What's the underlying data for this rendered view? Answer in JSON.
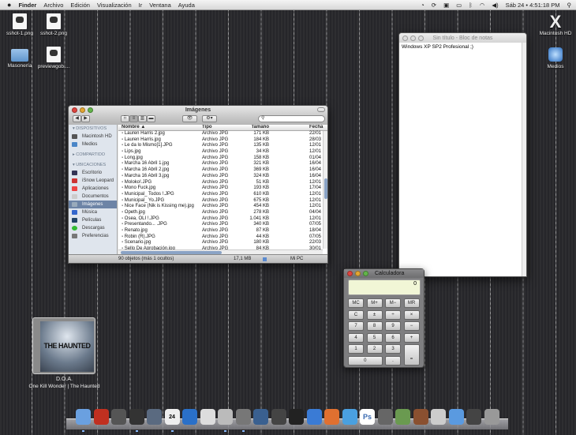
{
  "menubar": {
    "apple": "",
    "items": [
      "Finder",
      "Archivo",
      "Edición",
      "Visualización",
      "Ir",
      "Ventana",
      "Ayuda"
    ],
    "clock": "Sáb 24 • 4:51:18 PM",
    "status_icons": [
      "time-machine-icon",
      "sync-icon",
      "display-icon",
      "screen-icon",
      "bluetooth-icon",
      "wifi-icon",
      "volume-icon",
      "spotlight-icon"
    ]
  },
  "desktop": {
    "icons": [
      "sshot-1.png",
      "sshot-2.png",
      "Masonería",
      "previewgob....",
      "Macintosh HD",
      "Medios"
    ]
  },
  "finder": {
    "title": "Imágenes",
    "sidebar": {
      "devices_header": "DISPOSITIVOS",
      "devices": [
        "Macintosh HD",
        "Medios"
      ],
      "shared_header": "COMPARTIDO",
      "places_header": "UBICACIONES",
      "places": [
        "Escritorio",
        "iSnow Leopard",
        "Aplicaciones",
        "Documentos",
        "Imágenes",
        "Música",
        "Películas",
        "Descargas",
        "Preferencias"
      ],
      "selected": "Imágenes"
    },
    "columns": [
      "Nombre",
      "Tamaño",
      "Tipo",
      "Fecha"
    ],
    "rows": [
      [
        "Lauren Harris 2.jpg",
        "171 KB",
        "Archivo JPG",
        "22/01"
      ],
      [
        "Lauren Harris.jpg",
        "184 KB",
        "Archivo JPG",
        "28/03"
      ],
      [
        "Le da lo Mismo[1].JPG",
        "135 KB",
        "Archivo JPG",
        "12/01"
      ],
      [
        "Lips.jpg",
        "34 KB",
        "Archivo JPG",
        "12/01"
      ],
      [
        "Long.jpg",
        "158 KB",
        "Archivo JPG",
        "01/04"
      ],
      [
        "Marcha 16 Abril 1.jpg",
        "321 KB",
        "Archivo JPG",
        "16/04"
      ],
      [
        "Marcha 16 Abril 2.jpg",
        "369 KB",
        "Archivo JPG",
        "16/04"
      ],
      [
        "Marcha 16 Abril 3.jpg",
        "324 KB",
        "Archivo JPG",
        "16/04"
      ],
      [
        "Moloko!.JPG",
        "51 KB",
        "Archivo JPG",
        "12/01"
      ],
      [
        "Mono Fuck.jpg",
        "193 KB",
        "Archivo JPG",
        "17/04"
      ],
      [
        "Municipal_ Todos !.JPG",
        "610 KB",
        "Archivo JPG",
        "12/01"
      ],
      [
        "Municipal_ Yo.JPG",
        "675 KB",
        "Archivo JPG",
        "12/01"
      ],
      [
        "Nice Face (Nik is Kissing me).jpg",
        "454 KB",
        "Archivo JPG",
        "12/01"
      ],
      [
        "Opeth.jpg",
        "278 KB",
        "Archivo JPG",
        "04/04"
      ],
      [
        "Osea, OLI !.JPG",
        "1.041 KB",
        "Archivo JPG",
        "12/01"
      ],
      [
        "Presentando... .JPG",
        "340 KB",
        "Archivo JPG",
        "07/05"
      ],
      [
        "Renato.jpg",
        "87 KB",
        "Archivo JPG",
        "18/04"
      ],
      [
        "Robin (R).JPG",
        "44 KB",
        "Archivo JPG",
        "07/05"
      ],
      [
        "Scenario.jpg",
        "180 KB",
        "Archivo JPG",
        "22/03"
      ],
      [
        "Sello De Aprobación.jpg",
        "84 KB",
        "Archivo JPG",
        "30/01"
      ]
    ],
    "status": {
      "count": "90 objetos (más 1 ocultos)",
      "size": "17,1 MB",
      "location": "Mi PC"
    }
  },
  "notepad": {
    "title": "Sin título - Bloc de notas",
    "text": "Windows XP SP2 Profesional ;)"
  },
  "calculator": {
    "title": "Calculadora",
    "display": "0",
    "keys": [
      "MC",
      "M+",
      "M−",
      "MR",
      "C",
      "±",
      "÷",
      "×",
      "7",
      "8",
      "9",
      "−",
      "4",
      "5",
      "6",
      "+",
      "1",
      "2",
      "3",
      "=",
      "0",
      "."
    ]
  },
  "album": {
    "band_art": "THE HAUNTED",
    "title": "D.O.A.",
    "subtitle": "One Kill Wonder | The Haunted"
  },
  "dock": {
    "apps": [
      "finder",
      "photo-booth",
      "safari",
      "itunes",
      "iphoto",
      "ical",
      "quicktime",
      "textedit",
      "calculator",
      "preview",
      "image-capture",
      "garageband",
      "script-editor",
      "keynote",
      "keynote-presentation",
      "iweb",
      "photoshop",
      "gimp",
      "android",
      "abacus",
      "system-prefs",
      "app-store",
      "x11",
      "trash"
    ]
  }
}
